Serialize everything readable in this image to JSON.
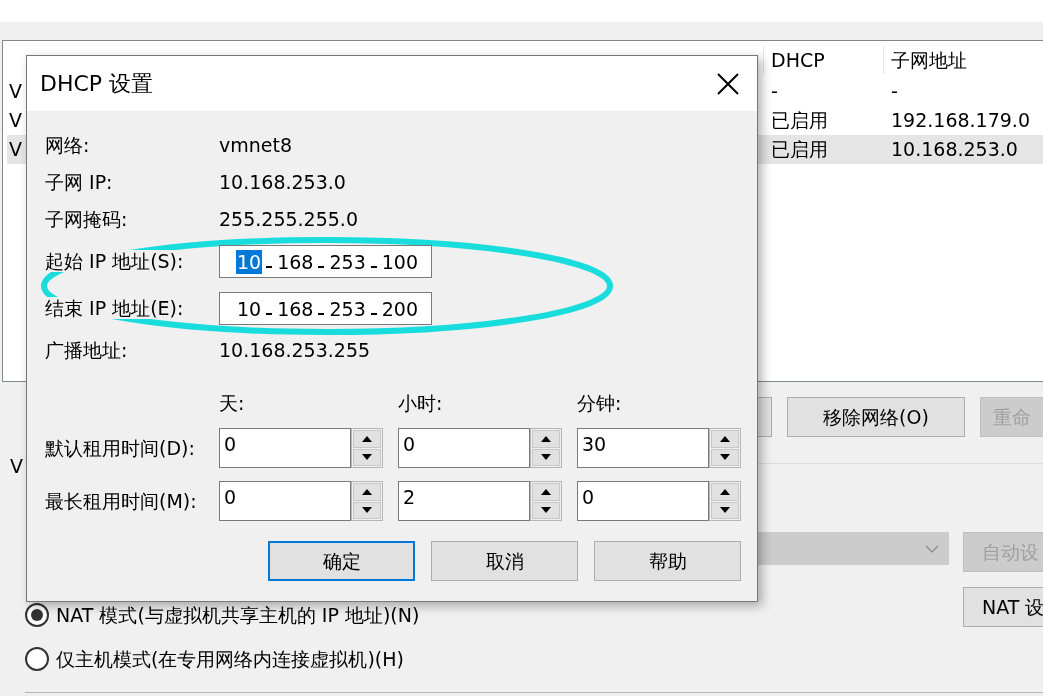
{
  "network_table": {
    "columns": [
      "DHCP",
      "子网地址"
    ],
    "rows": [
      {
        "name": "V",
        "dhcp": "-",
        "subnet": "-",
        "selected": false
      },
      {
        "name": "V",
        "dhcp": "已启用",
        "subnet": "192.168.179.0",
        "selected": false
      },
      {
        "name": "V",
        "dhcp": "已启用",
        "subnet": "10.168.253.0",
        "selected": true
      }
    ]
  },
  "network_buttons": [
    {
      "label": "移除网络(O)",
      "disabled": false
    },
    {
      "label": "重命",
      "disabled": true
    }
  ],
  "section_label": "V",
  "adapter_dropdown": {
    "disabled": true
  },
  "side_buttons": [
    {
      "label": "自动设",
      "disabled": true
    },
    {
      "label": "NAT 设",
      "disabled": false
    }
  ],
  "radios": [
    {
      "label": "NAT 模式(与虚拟机共享主机的 IP 地址)(N)",
      "selected": true
    },
    {
      "label": "仅主机模式(在专用网络内连接虚拟机)(H)",
      "selected": false
    }
  ],
  "dialog": {
    "title": "DHCP 设置",
    "fields": [
      {
        "kind": "text",
        "label": "网络:",
        "value": "vmnet8"
      },
      {
        "kind": "text",
        "label": "子网 IP:",
        "value": "10.168.253.0"
      },
      {
        "kind": "text",
        "label": "子网掩码:",
        "value": "255.255.255.0"
      },
      {
        "kind": "ip",
        "label": "起始 IP 地址(S):",
        "octets": [
          {
            "text": "10",
            "selected": true
          },
          {
            "text": "168",
            "selected": false
          },
          {
            "text": "253",
            "selected": false
          },
          {
            "text": "100",
            "selected": false
          }
        ]
      },
      {
        "kind": "ip",
        "label": "结束 IP 地址(E):",
        "octets": [
          {
            "text": "10",
            "selected": false
          },
          {
            "text": "168",
            "selected": false
          },
          {
            "text": "253",
            "selected": false
          },
          {
            "text": "200",
            "selected": false
          }
        ]
      },
      {
        "kind": "text",
        "label": "广播地址:",
        "value": "10.168.253.255"
      }
    ],
    "lease_columns": [
      "天:",
      "小时:",
      "分钟:"
    ],
    "lease_rows": [
      {
        "label": "默认租用时间(D):",
        "values": [
          "0",
          "0",
          "30"
        ]
      },
      {
        "label": "最长租用时间(M):",
        "values": [
          "0",
          "2",
          "0"
        ]
      }
    ],
    "buttons": [
      {
        "label": "确定",
        "default": true
      },
      {
        "label": "取消",
        "default": false
      },
      {
        "label": "帮助",
        "default": false
      }
    ]
  }
}
